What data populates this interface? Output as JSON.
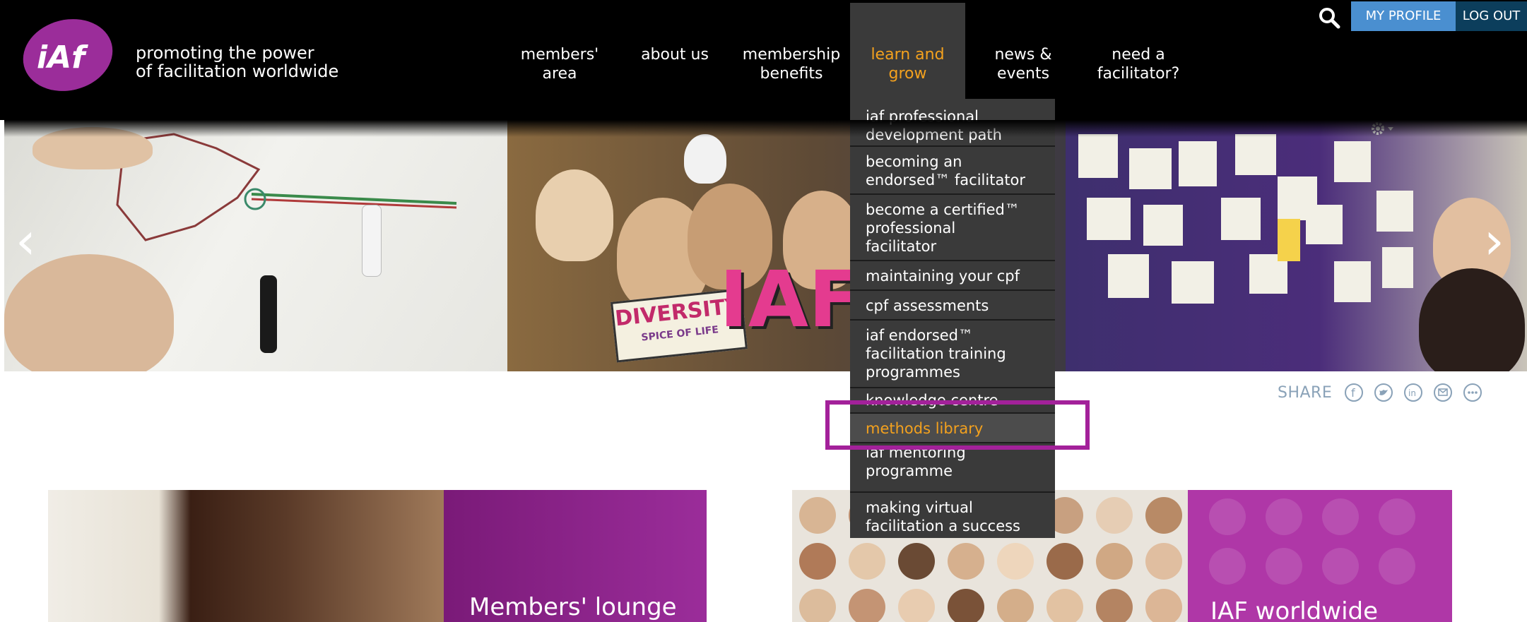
{
  "brand": {
    "logo_text": "iAf",
    "tagline_line1": "promoting the power",
    "tagline_line2": "of facilitation worldwide",
    "color_purple": "#9b2d9a",
    "color_orange": "#f3a11e"
  },
  "utility": {
    "search_icon": "search-icon",
    "my_profile": "MY PROFILE",
    "log_out": "LOG OUT"
  },
  "nav": [
    {
      "line1": "members'",
      "line2": "area"
    },
    {
      "line1": "about us",
      "line2": ""
    },
    {
      "line1": "membership",
      "line2": "benefits"
    },
    {
      "line1": "learn and",
      "line2": "grow",
      "active": true
    },
    {
      "line1": "news &",
      "line2": "events"
    },
    {
      "line1": "need a",
      "line2": "facilitator?"
    }
  ],
  "dropdown": {
    "items": [
      {
        "lines": [
          "iaf professional",
          "development path"
        ]
      },
      {
        "lines": [
          "becoming an",
          "endorsed™ facilitator"
        ]
      },
      {
        "lines": [
          "become a certified™",
          "professional",
          "facilitator"
        ]
      },
      {
        "lines": [
          "maintaining your cpf"
        ]
      },
      {
        "lines": [
          "cpf assessments"
        ]
      },
      {
        "lines": [
          "iaf endorsed™",
          "facilitation training",
          "programmes"
        ]
      },
      {
        "lines": [
          "knowledge centre"
        ]
      },
      {
        "lines": [
          "methods library"
        ],
        "highlighted": true
      },
      {
        "lines": [
          "iaf mentoring",
          "programme"
        ]
      },
      {
        "lines": [
          "making virtual",
          "facilitation a success"
        ]
      }
    ]
  },
  "hero": {
    "prev_arrow": "‹",
    "next_arrow": "›",
    "sign_text": "DIVERSITY",
    "sign_subtext": "SPICE OF LIFE",
    "sign_letters": "IAF"
  },
  "share": {
    "label": "SHARE",
    "icons": [
      "facebook-icon",
      "twitter-icon",
      "linkedin-icon",
      "email-icon",
      "more-icon"
    ]
  },
  "cards": {
    "left_title": "Members' lounge",
    "right_title": "IAF worldwide"
  }
}
